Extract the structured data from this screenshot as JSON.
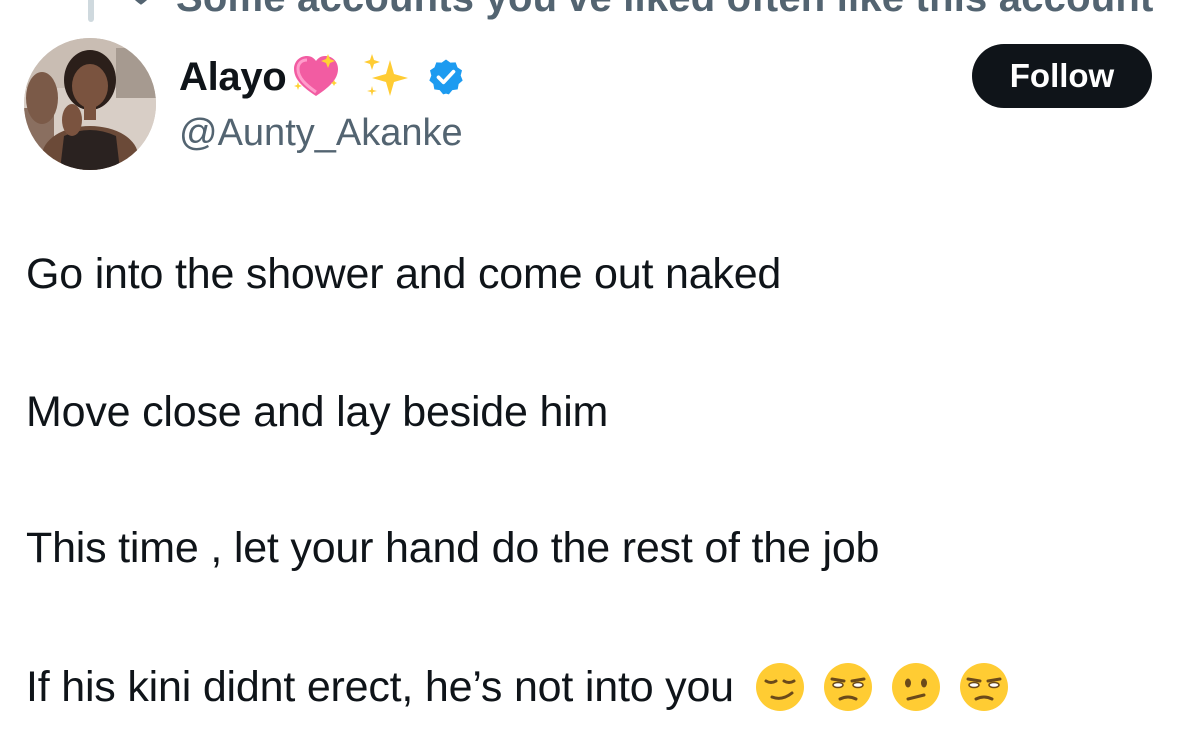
{
  "context": {
    "text": "Some accounts you've liked often like this account",
    "icon": "heart-icon"
  },
  "profile": {
    "display_name": "Alayo",
    "name_emojis": [
      "sparkling-heart-emoji",
      "sparkles-emoji"
    ],
    "verified": true,
    "verified_color": "#1d9bf0",
    "handle": "@Aunty_Akanke",
    "avatar": "profile-photo"
  },
  "actions": {
    "follow_label": "Follow"
  },
  "tweet": {
    "lines": [
      "Go into the shower and come out naked",
      "Move close and lay beside him",
      "This time , let your hand do the rest of the job",
      "If his kini didnt erect, he’s not into you"
    ],
    "trailing_emojis": [
      "smirking-face-emoji",
      "unamused-face-emoji",
      "confused-face-emoji",
      "unamused-face-emoji"
    ]
  },
  "colors": {
    "text_primary": "#0f1419",
    "text_secondary": "#536471",
    "button_bg": "#0f1419",
    "button_text": "#ffffff"
  }
}
